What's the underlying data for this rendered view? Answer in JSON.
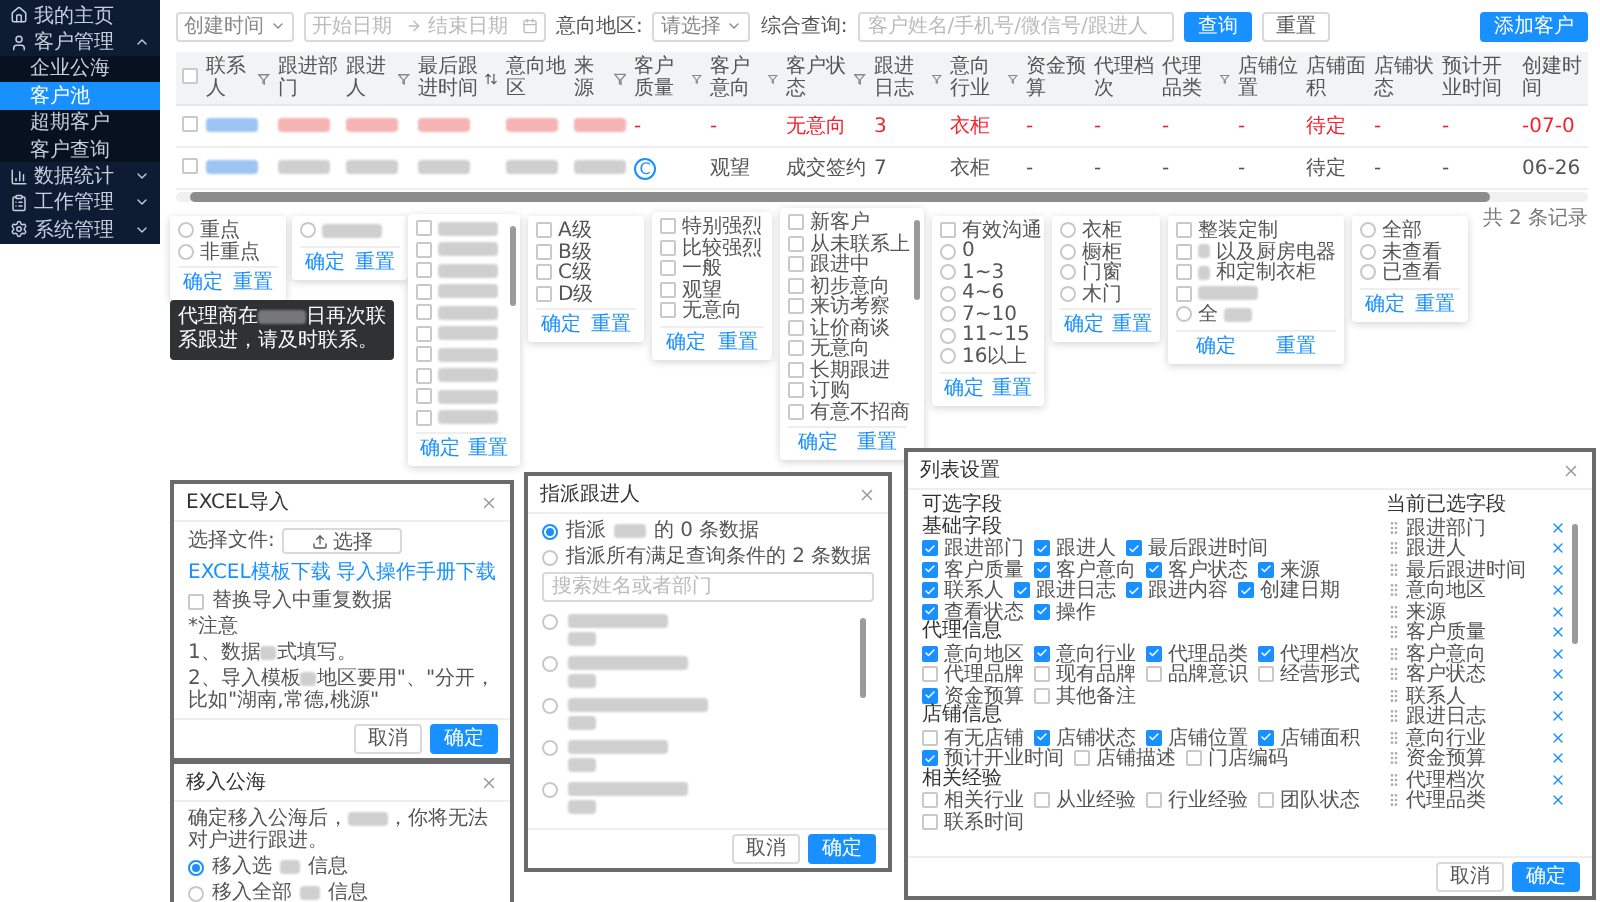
{
  "sidebar": {
    "items": [
      {
        "label": "我的主页"
      },
      {
        "label": "客户管理",
        "expanded": true,
        "children": [
          {
            "label": "企业公海",
            "selected": false
          },
          {
            "label": "客户池",
            "selected": true
          },
          {
            "label": "超期客户",
            "selected": false
          },
          {
            "label": "客户查询",
            "selected": false
          }
        ]
      },
      {
        "label": "数据统计",
        "expanded": false
      },
      {
        "label": "工作管理",
        "expanded": false
      },
      {
        "label": "系统管理",
        "expanded": false
      }
    ]
  },
  "filters": {
    "time_select": "创建时间",
    "start_placeholder": "开始日期",
    "end_placeholder": "结束日期",
    "region_label": "意向地区:",
    "region_select": "请选择",
    "query_label": "综合查询:",
    "query_placeholder": "客户姓名/手机号/微信号/跟进人",
    "search_button": "查询",
    "reset_button": "重置",
    "add_button": "添加客户"
  },
  "table": {
    "select_all_checked": false,
    "columns": [
      {
        "label": "联系人",
        "filter": true
      },
      {
        "label": "跟进部门"
      },
      {
        "label": "跟进人",
        "filter": true
      },
      {
        "label": "最后跟进时间",
        "sort": true
      },
      {
        "label": "意向地区"
      },
      {
        "label": "来源",
        "filter": true
      },
      {
        "label": "客户质量",
        "filter": true
      },
      {
        "label": "客户意向",
        "filter": true
      },
      {
        "label": "客户状态",
        "filter": true
      },
      {
        "label": "跟进日志",
        "filter": true
      },
      {
        "label": "意向行业",
        "filter": true
      },
      {
        "label": "资金预算"
      },
      {
        "label": "代理档次"
      },
      {
        "label": "代理品类",
        "filter": true
      },
      {
        "label": "店铺位置"
      },
      {
        "label": "店铺面积"
      },
      {
        "label": "店铺状态"
      },
      {
        "label": "预计开业时间"
      },
      {
        "label": "创建时间"
      }
    ],
    "rows": [
      {
        "alert": true,
        "checked": false,
        "cells": [
          {
            "kind": "redacted"
          },
          {
            "kind": "redacted"
          },
          {
            "kind": "redacted"
          },
          {
            "kind": "redacted"
          },
          {
            "kind": "redacted"
          },
          {
            "kind": "redacted"
          },
          {
            "kind": "text",
            "text": "-"
          },
          {
            "kind": "text",
            "text": "-"
          },
          {
            "kind": "text",
            "text": "无意向"
          },
          {
            "kind": "text",
            "text": "3"
          },
          {
            "kind": "text",
            "text": "衣柜"
          },
          {
            "kind": "text",
            "text": "-"
          },
          {
            "kind": "text",
            "text": "-"
          },
          {
            "kind": "text",
            "text": "-"
          },
          {
            "kind": "text",
            "text": "-"
          },
          {
            "kind": "text",
            "text": "待定"
          },
          {
            "kind": "text",
            "text": "-"
          },
          {
            "kind": "text",
            "text": "-"
          },
          {
            "kind": "text",
            "text": "-07-0"
          }
        ]
      },
      {
        "alert": false,
        "checked": false,
        "cells": [
          {
            "kind": "redacted"
          },
          {
            "kind": "redacted"
          },
          {
            "kind": "redacted"
          },
          {
            "kind": "redacted"
          },
          {
            "kind": "redacted"
          },
          {
            "kind": "redacted"
          },
          {
            "kind": "grade",
            "text": "C"
          },
          {
            "kind": "text",
            "text": "观望"
          },
          {
            "kind": "text",
            "text": "成交签约"
          },
          {
            "kind": "text",
            "text": "7"
          },
          {
            "kind": "text",
            "text": "衣柜"
          },
          {
            "kind": "text",
            "text": "-"
          },
          {
            "kind": "text",
            "text": "-"
          },
          {
            "kind": "text",
            "text": "-"
          },
          {
            "kind": "text",
            "text": "-"
          },
          {
            "kind": "text",
            "text": "待定"
          },
          {
            "kind": "text",
            "text": "-"
          },
          {
            "kind": "text",
            "text": "-"
          },
          {
            "kind": "text",
            "text": "06-26"
          }
        ]
      }
    ]
  },
  "record_count": "共 2 条记录",
  "popovers": [
    {
      "confirm": "确定",
      "reset": "重置",
      "options": [
        {
          "kind": "radio",
          "label": "重点",
          "checked": false
        },
        {
          "kind": "radio",
          "label": "非重点",
          "checked": false
        }
      ]
    },
    {
      "confirm": "确定",
      "reset": "重置",
      "options": [
        {
          "kind": "radio",
          "blur_before": true,
          "checked": false
        }
      ]
    },
    {
      "confirm": "确定",
      "reset": "重置",
      "options": [
        {
          "kind": "checkbox",
          "blur_before": true,
          "checked": false
        },
        {
          "kind": "checkbox",
          "blur_before": true,
          "checked": false
        },
        {
          "kind": "checkbox",
          "blur_before": true,
          "checked": false
        },
        {
          "kind": "checkbox",
          "blur_before": true,
          "checked": false
        },
        {
          "kind": "checkbox",
          "blur_before": true,
          "checked": false
        },
        {
          "kind": "checkbox",
          "blur_before": true,
          "checked": false
        },
        {
          "kind": "checkbox",
          "blur_before": true,
          "checked": false
        },
        {
          "kind": "checkbox",
          "blur_before": true,
          "checked": false
        },
        {
          "kind": "checkbox",
          "blur_before": true,
          "checked": false
        },
        {
          "kind": "checkbox",
          "blur_before": true,
          "checked": false
        }
      ]
    },
    {
      "confirm": "确定",
      "reset": "重置",
      "options": [
        {
          "kind": "checkbox",
          "label": "A级",
          "checked": false
        },
        {
          "kind": "checkbox",
          "label": "B级",
          "checked": false
        },
        {
          "kind": "checkbox",
          "label": "C级",
          "checked": false
        },
        {
          "kind": "checkbox",
          "label": "D级",
          "checked": false
        }
      ]
    },
    {
      "confirm": "确定",
      "reset": "重置",
      "options": [
        {
          "kind": "checkbox",
          "label": "特别强烈",
          "checked": false
        },
        {
          "kind": "checkbox",
          "label": "比较强烈",
          "checked": false
        },
        {
          "kind": "checkbox",
          "label": "一般",
          "checked": false
        },
        {
          "kind": "checkbox",
          "label": "观望",
          "checked": false
        },
        {
          "kind": "checkbox",
          "label": "无意向",
          "checked": false
        }
      ]
    },
    {
      "confirm": "确定",
      "reset": "重置",
      "options": [
        {
          "kind": "checkbox",
          "label": "新客户",
          "checked": false
        },
        {
          "kind": "checkbox",
          "label": "从未联系上",
          "checked": false
        },
        {
          "kind": "checkbox",
          "label": "跟进中",
          "checked": false
        },
        {
          "kind": "checkbox",
          "label": "初步意向",
          "checked": false
        },
        {
          "kind": "checkbox",
          "label": "来访考察",
          "checked": false
        },
        {
          "kind": "checkbox",
          "label": "让价商谈",
          "checked": false
        },
        {
          "kind": "checkbox",
          "label": "无意向",
          "checked": false
        },
        {
          "kind": "checkbox",
          "label": "长期跟进",
          "checked": false
        },
        {
          "kind": "checkbox",
          "label": "订购",
          "checked": false
        },
        {
          "kind": "checkbox",
          "label": "有意不招商",
          "checked": false
        }
      ]
    },
    {
      "confirm": "确定",
      "reset": "重置",
      "options": [
        {
          "kind": "checkbox",
          "label": "有效沟通",
          "checked": false
        },
        {
          "kind": "radio",
          "label": "0",
          "checked": false
        },
        {
          "kind": "radio",
          "label": "1~3",
          "checked": false
        },
        {
          "kind": "radio",
          "label": "4~6",
          "checked": false
        },
        {
          "kind": "radio",
          "label": "7~10",
          "checked": false
        },
        {
          "kind": "radio",
          "label": "11~15",
          "checked": false
        },
        {
          "kind": "radio",
          "label": "16以上",
          "checked": false
        }
      ]
    },
    {
      "confirm": "确定",
      "reset": "重置",
      "options": [
        {
          "kind": "radio",
          "label": "衣柜",
          "checked": false
        },
        {
          "kind": "radio",
          "label": "橱柜",
          "checked": false
        },
        {
          "kind": "radio",
          "label": "门窗",
          "checked": false
        },
        {
          "kind": "radio",
          "label": "木门",
          "checked": false
        }
      ]
    },
    {
      "confirm": "确定",
      "reset": "重置",
      "options": [
        {
          "kind": "checkbox",
          "label": "整装定制",
          "checked": false
        },
        {
          "kind": "checkbox",
          "label": "以及厨房电器",
          "blur_before": true,
          "checked": false
        },
        {
          "kind": "checkbox",
          "label": "和定制衣柜",
          "blur_before": true,
          "checked": false
        },
        {
          "kind": "checkbox",
          "blur_before": true,
          "checked": false
        },
        {
          "kind": "radio",
          "label": "全",
          "blur_after": true,
          "checked": false
        }
      ]
    },
    {
      "confirm": "确定",
      "reset": "重置",
      "options": [
        {
          "kind": "radio",
          "label": "全部",
          "checked": false
        },
        {
          "kind": "radio",
          "label": "未查看",
          "checked": false
        },
        {
          "kind": "radio",
          "label": "已查看",
          "checked": false
        }
      ]
    }
  ],
  "tooltip": {
    "before": "代理商在",
    "after": "日再次联系跟进，请及时联系。"
  },
  "excel_import": {
    "title": "EXCEL导入",
    "file_label": "选择文件:",
    "file_button": "选择",
    "template_link": "EXCEL模板下载",
    "manual_link": "导入操作手册下载",
    "replace_option": {
      "label": "替换导入中重复数据",
      "checked": false
    },
    "notice_title": "*注意",
    "notes": [
      {
        "before": "1、数据",
        "after": "式填写。"
      },
      {
        "before": "2、导入模板",
        "after": "地区要用\"、\"分开，比如\"湖南,常德,桃源\""
      }
    ],
    "cancel": "取消",
    "confirm": "确定"
  },
  "move_to_pool": {
    "title": "移入公海",
    "message_before": "确定移入公海后，",
    "message_after": "，你将无法对户进行跟进。",
    "options": [
      {
        "before": "移入选",
        "after": "信息",
        "selected": true
      },
      {
        "before": "移入全部",
        "after": "信息",
        "selected": false
      }
    ]
  },
  "assign": {
    "title": "指派跟进人",
    "options": [
      {
        "before": "指派",
        "after": "的 0 条数据",
        "selected": true
      },
      {
        "before": "指派所有满足查询条件的 2 条数据",
        "selected": false
      }
    ],
    "search_placeholder": "搜索姓名或者部门",
    "people": [
      {
        "selected": false
      },
      {
        "selected": false
      },
      {
        "selected": false
      },
      {
        "selected": false
      },
      {
        "selected": false
      }
    ],
    "cancel": "取消",
    "confirm": "确定"
  },
  "column_settings": {
    "title": "列表设置",
    "available_title": "可选字段",
    "selected_title": "当前已选字段",
    "groups": [
      {
        "title": "基础字段",
        "fields": [
          {
            "label": "跟进部门",
            "checked": true
          },
          {
            "label": "跟进人",
            "checked": true
          },
          {
            "label": "最后跟进时间",
            "checked": true
          },
          {
            "label": "客户质量",
            "checked": true
          },
          {
            "label": "客户意向",
            "checked": true
          },
          {
            "label": "客户状态",
            "checked": true
          },
          {
            "label": "来源",
            "checked": true
          },
          {
            "label": "联系人",
            "checked": true
          },
          {
            "label": "跟进日志",
            "checked": true
          },
          {
            "label": "跟进内容",
            "checked": true
          },
          {
            "label": "创建日期",
            "checked": true
          },
          {
            "label": "查看状态",
            "checked": true
          },
          {
            "label": "操作",
            "checked": true
          }
        ]
      },
      {
        "title": "代理信息",
        "fields": [
          {
            "label": "意向地区",
            "checked": true
          },
          {
            "label": "意向行业",
            "checked": true
          },
          {
            "label": "代理品类",
            "checked": true
          },
          {
            "label": "代理档次",
            "checked": true
          },
          {
            "label": "代理品牌",
            "checked": false
          },
          {
            "label": "现有品牌",
            "checked": false
          },
          {
            "label": "品牌意识",
            "checked": false
          },
          {
            "label": "经营形式",
            "checked": false
          },
          {
            "label": "资金预算",
            "checked": true
          },
          {
            "label": "其他备注",
            "checked": false
          }
        ]
      },
      {
        "title": "店铺信息",
        "fields": [
          {
            "label": "有无店铺",
            "checked": false
          },
          {
            "label": "店铺状态",
            "checked": true
          },
          {
            "label": "店铺位置",
            "checked": true
          },
          {
            "label": "店铺面积",
            "checked": true
          },
          {
            "label": "预计开业时间",
            "checked": true
          },
          {
            "label": "店铺描述",
            "checked": false
          },
          {
            "label": "门店编码",
            "checked": false
          }
        ]
      },
      {
        "title": "相关经验",
        "fields": [
          {
            "label": "相关行业",
            "checked": false
          },
          {
            "label": "从业经验",
            "checked": false
          },
          {
            "label": "行业经验",
            "checked": false
          },
          {
            "label": "团队状态",
            "checked": false
          },
          {
            "label": "联系时间",
            "checked": false
          }
        ]
      }
    ],
    "selected_fields": [
      "跟进部门",
      "跟进人",
      "最后跟进时间",
      "意向地区",
      "来源",
      "客户质量",
      "客户意向",
      "客户状态",
      "联系人",
      "跟进日志",
      "意向行业",
      "资金预算",
      "代理档次",
      "代理品类"
    ],
    "cancel": "取消",
    "confirm": "确定"
  }
}
